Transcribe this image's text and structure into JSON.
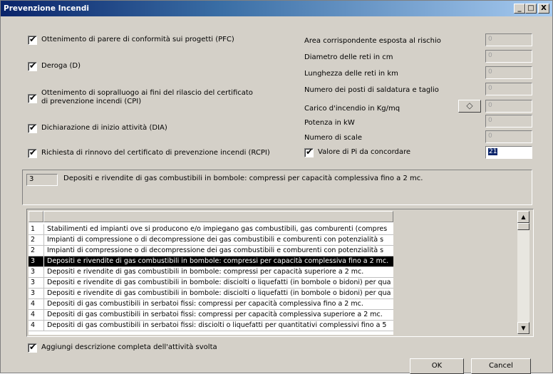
{
  "window": {
    "title": "Prevenzione Incendi",
    "min_glyph": "_",
    "max_glyph": "□",
    "close_glyph": "X"
  },
  "left_options": [
    {
      "label": "Ottenimento di parere di conformità sui progetti (PFC)",
      "checked": true
    },
    {
      "label": "Deroga (D)",
      "checked": true
    },
    {
      "label": "Ottenimento di sopralluogo ai fini del rilascio del certificato di prevenzione incendi (CPI)",
      "checked": true
    },
    {
      "label": "Dichiarazione di inizio attività (DIA)",
      "checked": true
    },
    {
      "label": "Richiesta di rinnovo del certificato di prevenzione incendi (RCPI)",
      "checked": true
    }
  ],
  "right_fields": [
    {
      "label": "Area corrispondente esposta al rischio",
      "value": "0"
    },
    {
      "label": "Diametro delle reti in cm",
      "value": "0"
    },
    {
      "label": "Lunghezza delle reti in km",
      "value": "0"
    },
    {
      "label": "Numero dei posti di saldatura e taglio",
      "value": "0"
    },
    {
      "label": "Carico d'incendio in Kg/mq",
      "value": "0"
    },
    {
      "label": "Potenza in kW",
      "value": "0"
    },
    {
      "label": "Numero di scale",
      "value": "0"
    }
  ],
  "valore_pi": {
    "label": "Valore di Pi da concordare",
    "checked": true,
    "value": "21"
  },
  "detail": {
    "code": "3",
    "text": "Depositi e rivendite di gas combustibili in bombole: compressi per capacità complessiva fino a 2 mc."
  },
  "activity_list": [
    {
      "n": "1",
      "text": "Stabilimenti ed impianti ove si producono e/o impiegano gas combustibili, gas comburenti (compres"
    },
    {
      "n": "2",
      "text": "Impianti di compressione o di decompressione dei gas combustibili e comburenti con potenzialità s"
    },
    {
      "n": "2",
      "text": "Impianti di compressione o di decompressione dei gas combustibili e comburenti con potenzialità s"
    },
    {
      "n": "3",
      "text": "Depositi e rivendite di gas combustibili in bombole: compressi per capacità complessiva fino a 2 mc.",
      "selected": true
    },
    {
      "n": "3",
      "text": "Depositi e rivendite di gas combustibili in bombole: compressi per capacità superiore a 2 mc."
    },
    {
      "n": "3",
      "text": "Depositi e rivendite di gas combustibili in bombole: disciolti o liquefatti (in bombole o bidoni) per qua"
    },
    {
      "n": "3",
      "text": "Depositi e rivendite di gas combustibili in bombole: disciolti o liquefatti (in bombole o bidoni) per qua"
    },
    {
      "n": "4",
      "text": "Depositi di gas combustibili in serbatoi fissi: compressi per capacità complessiva fino a 2 mc."
    },
    {
      "n": "4",
      "text": "Depositi di gas combustibili in serbatoi fissi: compressi per capacità complessiva superiore a 2 mc."
    },
    {
      "n": "4",
      "text": "Depositi di gas combustibili in serbatoi fissi: disciolti o liquefatti per quantitativi complessivi fino a 5"
    }
  ],
  "add_description": {
    "label": "Aggiungi descrizione completa dell'attività svolta",
    "checked": true
  },
  "buttons": {
    "ok": "OK",
    "cancel": "Cancel"
  },
  "icons": {
    "lookup": "eye-icon",
    "checkbox_mark": "✔"
  }
}
